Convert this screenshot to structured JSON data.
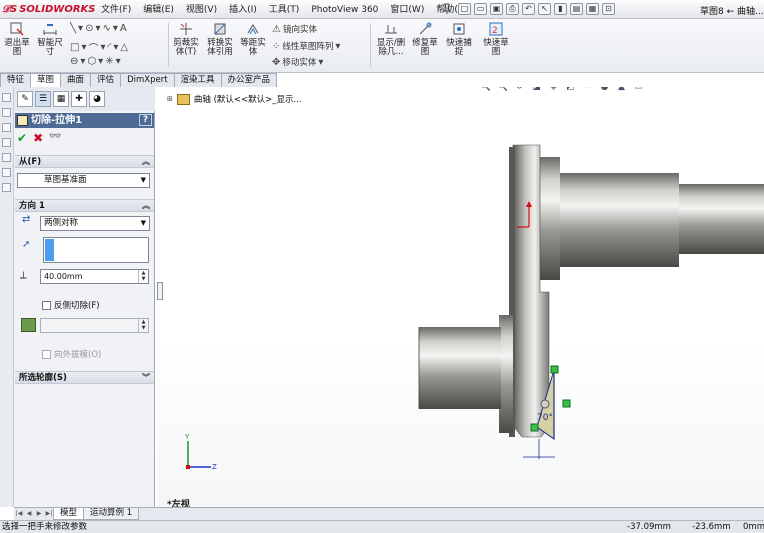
{
  "app": {
    "brand": "SOLIDWORKS",
    "document_title": "草图8 ← 曲轴..."
  },
  "menu": [
    "文件(F)",
    "编辑(E)",
    "视图(V)",
    "插入(I)",
    "工具(T)",
    "PhotoView 360",
    "窗口(W)",
    "帮助(H)"
  ],
  "ribbon": {
    "exit_sketch": "退出草图",
    "smart_dimension": "智能尺寸",
    "trim_entities": "剪裁实体(T)",
    "convert_entities": "转换实体引用",
    "offset_entities": "等距实体",
    "mirror_entities": "镜向实体",
    "linear_pattern": "线性草图阵列",
    "move_entities": "移动实体",
    "display_delete_relations": "显示/删除几...",
    "repair_sketch": "修复草图",
    "rapid_snaps": "快速捕捉",
    "rapid_sketch": "快速草图"
  },
  "tabs": [
    "特征",
    "草图",
    "曲面",
    "评估",
    "DimXpert",
    "渲染工具",
    "办公室产品"
  ],
  "active_tab": "草图",
  "property_manager": {
    "title": "切除-拉伸1",
    "help": "?",
    "from_group": {
      "label": "从(F)",
      "value": "草图基准面"
    },
    "direction_group": {
      "label": "方向 1",
      "end_condition": "两侧对称",
      "depth": "40.00mm",
      "flip_side_label": "反侧切除(F)",
      "draft_outward_label": "向外拔模(O)"
    },
    "selected_contours": {
      "label": "所选轮廓(S)"
    }
  },
  "graphics": {
    "tree_root_label": "曲轴 (默认<<默认>_显示...",
    "view_label": "*左视",
    "dimension_angle": "70°"
  },
  "bottom_tabs": [
    "模型",
    "运动算例 1"
  ],
  "status": {
    "message": "选择一把手来修改参数",
    "x": "-37.09mm",
    "y": "-23.6mm",
    "z": "0mm"
  }
}
